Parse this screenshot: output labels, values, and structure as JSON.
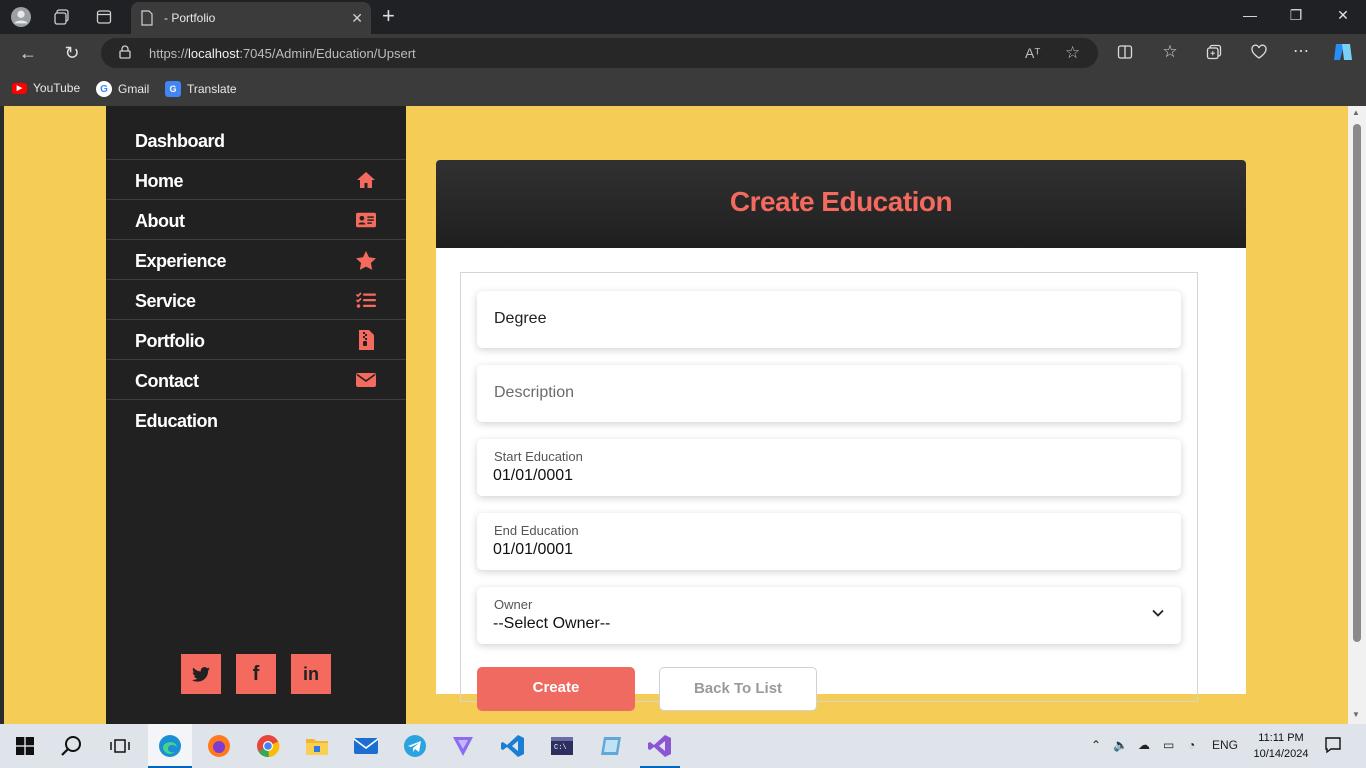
{
  "browser": {
    "tab_title": "- Portfolio",
    "url_prefix": "https://",
    "url_host": "localhost",
    "url_path": ":7045/Admin/Education/Upsert",
    "read_aloud": "Aᵀ",
    "bookmarks": [
      {
        "label": "YouTube",
        "icon": "youtube-icon"
      },
      {
        "label": "Gmail",
        "icon": "google-icon"
      },
      {
        "label": "Translate",
        "icon": "translate-icon"
      }
    ]
  },
  "sidebar": {
    "items": [
      {
        "label": "Dashboard",
        "icon": ""
      },
      {
        "label": "Home",
        "icon": "home-icon"
      },
      {
        "label": "About",
        "icon": "id-card-icon"
      },
      {
        "label": "Experience",
        "icon": "star-icon"
      },
      {
        "label": "Service",
        "icon": "tasks-icon"
      },
      {
        "label": "Portfolio",
        "icon": "file-zip-icon"
      },
      {
        "label": "Contact",
        "icon": "envelope-icon"
      },
      {
        "label": "Education",
        "icon": ""
      }
    ],
    "social": [
      {
        "glyph": "🐦",
        "icon": "twitter-icon"
      },
      {
        "glyph": "f",
        "icon": "facebook-icon"
      },
      {
        "glyph": "in",
        "icon": "linkedin-icon"
      }
    ],
    "accent_color": "#f46a5e"
  },
  "form": {
    "title": "Create Education",
    "degree_placeholder": "Degree",
    "description_placeholder": "Description",
    "start_label": "Start Education",
    "start_value": "01/01/0001",
    "end_label": "End Education",
    "end_value": "01/01/0001",
    "owner_label": "Owner",
    "owner_value": "--Select Owner--",
    "create_label": "Create",
    "back_label": "Back To List"
  },
  "taskbar": {
    "lang": "ENG",
    "time": "11:11 PM",
    "date": "10/14/2024"
  }
}
